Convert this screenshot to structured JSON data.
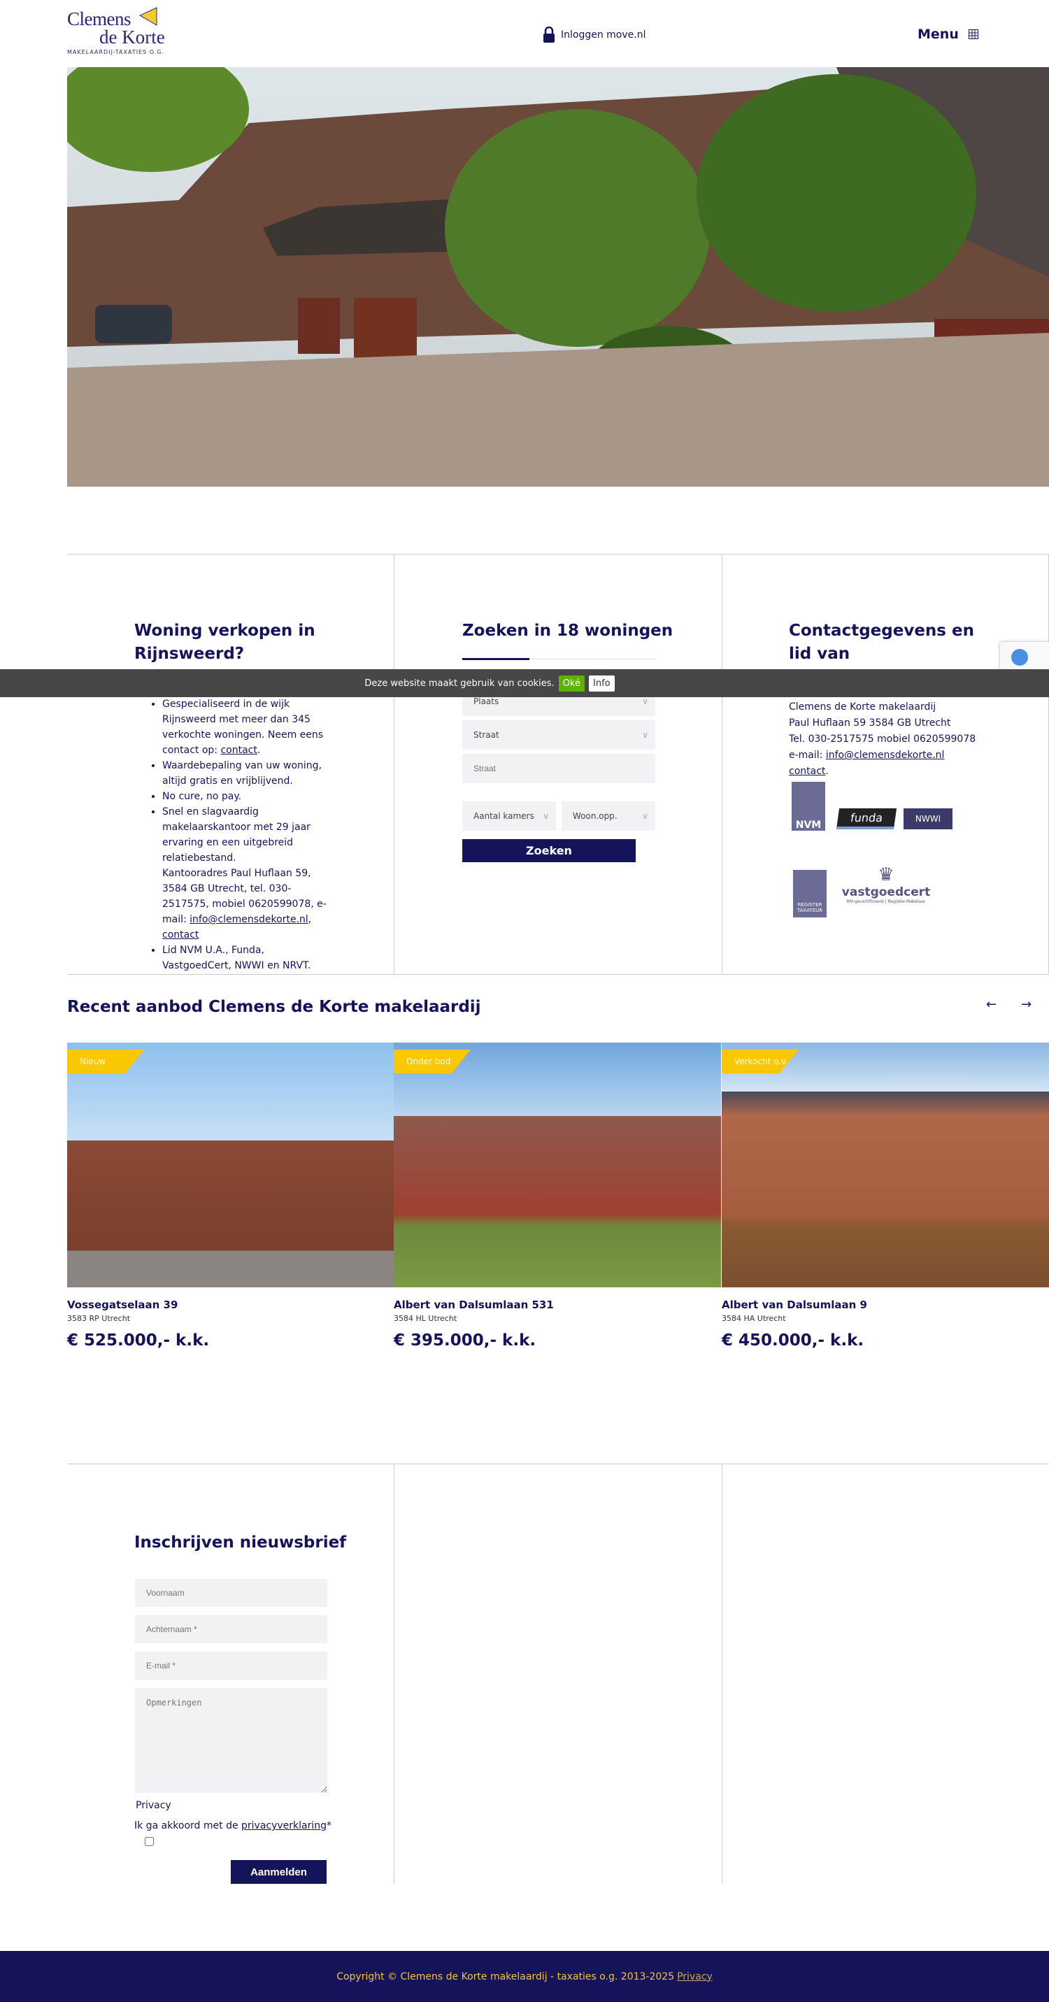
{
  "header": {
    "logo": {
      "line1": "Clemens",
      "line2": "de Korte",
      "tagline": "MAKELAARDIJ-TAXATIES O.G."
    },
    "login_label": "Inloggen move.nl",
    "menu_label": "Menu"
  },
  "colors": {
    "navy": "#15145a",
    "yellow": "#f9c800",
    "cookie_bg": "#474747",
    "ok_green": "#5ab500"
  },
  "col1": {
    "title": "Woning verkopen in Rijnsweerd?",
    "items": [
      {
        "text": "Gespecialiseerd in de wijk Rijnsweerd met meer dan 345 verkochte woningen. Neem eens contact op: ",
        "link": "contact",
        "after": "."
      },
      {
        "text": "Waardebepaling van uw woning, altijd gratis en vrijblijvend."
      },
      {
        "text": "No cure, no pay."
      },
      {
        "text": "Snel en slagvaardig makelaarskantoor met 29 jaar ervaring en een uitgebreid relatiebestand."
      },
      {
        "text": "Kantooradres Paul Huflaan 59, 3584 GB  Utrecht, tel. 030-2517575, mobiel 0620599078, e-mail: ",
        "link": "info@clemensdekorte.nl",
        "after": ", ",
        "link2": "contact"
      },
      {
        "text": "Lid NVM U.A., Funda, VastgoedCert, NWWI en NRVT."
      }
    ]
  },
  "search": {
    "title": "Zoeken in 18 woningen",
    "plaats": "Plaats",
    "straat_select": "Straat",
    "straat_placeholder": "Straat",
    "kamers": "Aantal kamers",
    "woonopp": "Woon.opp.",
    "button": "Zoeken"
  },
  "contact": {
    "title": "Contactgegevens en lid van",
    "line0": "Clemens de Korte makelaardij",
    "line1": "Paul Huflaan 59 3584 GB  Utrecht",
    "line2": "Tel. 030-2517575 mobiel 0620599078",
    "email_prefix": "e-mail: ",
    "email": "info@clemensdekorte.nl",
    "contact_link": "contact",
    "logos": [
      "NVM",
      "funda",
      "NWWI",
      "REGISTER TAXATEUR",
      "vastgoedcert"
    ],
    "vgc_sub": "RM-gecertificeerd | Register-Makelaar"
  },
  "cookie": {
    "text": "Deze website maakt gebruik van cookies.",
    "ok": "Oké",
    "info": "Info"
  },
  "recent": {
    "title": "Recent aanbod Clemens de Korte makelaardij",
    "prev": "←",
    "next": "→",
    "listings": [
      {
        "badge": "Nieuw",
        "street": "Vossegatselaan 39",
        "city": "3583 RP Utrecht",
        "price": "€ 525.000,- k.k."
      },
      {
        "badge": "Onder bod",
        "street": "Albert van Dalsumlaan 531",
        "city": "3584 HL Utrecht",
        "price": "€ 395.000,- k.k."
      },
      {
        "badge": "Verkocht o.v.",
        "street": "Albert van Dalsumlaan 9",
        "city": "3584 HA Utrecht",
        "price": "€ 450.000,- k.k."
      }
    ]
  },
  "newsletter": {
    "title": "Inschrijven nieuwsbrief",
    "voornaam": "Voornaam",
    "achternaam": "Achternaam *",
    "email": "E-mail *",
    "opmerkingen": "Opmerkingen",
    "privacy_label": "Privacy",
    "agree_prefix": "Ik ga akkoord met de ",
    "agree_link": "privacyverklaring",
    "agree_suffix": "*",
    "button": "Aanmelden"
  },
  "footer": {
    "text": "Copyright © Clemens de Korte makelaardij - taxaties o.g. 2013-2025",
    "privacy": "Privacy"
  }
}
